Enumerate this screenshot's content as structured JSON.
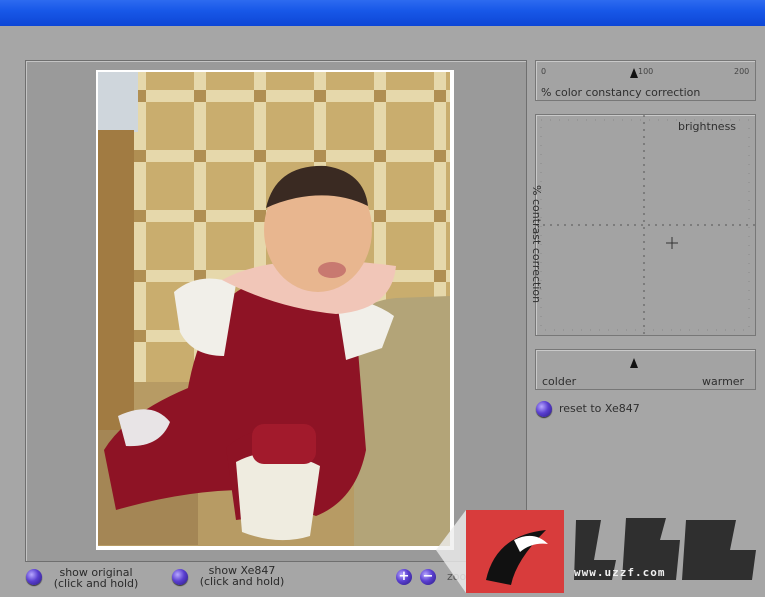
{
  "color_constancy": {
    "ticks": [
      "0",
      "100",
      "200"
    ],
    "label": "% color constancy correction",
    "value": 95
  },
  "brightness_contrast": {
    "brightness_label": "brightness",
    "contrast_label": "% contrast correction"
  },
  "temperature": {
    "left_label": "colder",
    "right_label": "warmer"
  },
  "reset_button": {
    "label": "reset to Xe847"
  },
  "bottom_bar": {
    "show_original_line1": "show original",
    "show_original_line2": "(click and hold)",
    "show_xe_line1": "show Xe847",
    "show_xe_line2": "(click and hold)",
    "zoom_in_glyph": "+",
    "zoom_out_glyph": "−",
    "zoom_label": "zoom in/out"
  },
  "watermark": {
    "url_text": "www.uzzf.com"
  },
  "colors": {
    "titlebar": "#1858e8",
    "background": "#a6a6a6",
    "button_accent": "#5a3fd0"
  }
}
